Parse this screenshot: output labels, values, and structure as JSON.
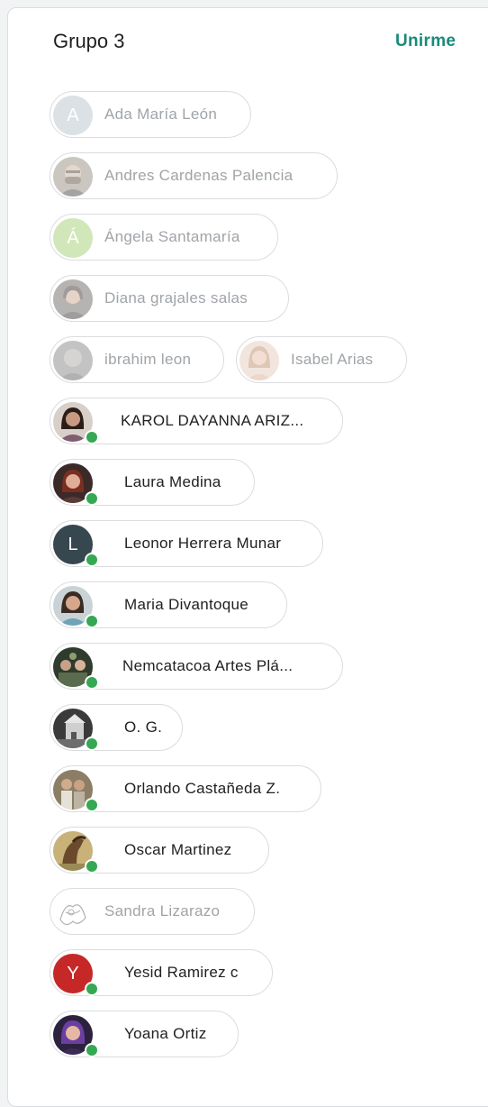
{
  "header": {
    "title": "Grupo 3",
    "join_label": "Unirme"
  },
  "colors": {
    "accent": "#1a8a7a",
    "online": "#34a853",
    "away_text": "#a0a4a8"
  },
  "participants": [
    {
      "name": "Ada María León",
      "initial": "A",
      "status": "away",
      "avatar": "letter",
      "color": "#b0bec5"
    },
    {
      "name": "Andres Cardenas Palencia",
      "status": "away",
      "avatar": "photo-man-beard-icon"
    },
    {
      "name": "Ángela Santamaría",
      "initial": "Á",
      "status": "away",
      "avatar": "letter",
      "color": "#9ccc65"
    },
    {
      "name": "Diana grajales salas",
      "status": "away",
      "avatar": "photo-woman-icon"
    },
    {
      "name": "ibrahim leon",
      "status": "away",
      "avatar": "photo-grey-icon"
    },
    {
      "name": "Isabel Arias",
      "status": "away",
      "avatar": "photo-woman-blonde-icon"
    },
    {
      "name": "KAROL DAYANNA ARIZ...",
      "status": "online",
      "avatar": "photo-woman-icon"
    },
    {
      "name": "Laura Medina",
      "status": "online",
      "avatar": "photo-woman-red-icon"
    },
    {
      "name": "Leonor Herrera Munar",
      "initial": "L",
      "status": "online",
      "avatar": "letter",
      "color": "#37474f"
    },
    {
      "name": "Maria Divantoque",
      "status": "online",
      "avatar": "photo-woman-icon"
    },
    {
      "name": "Nemcatacoa Artes Plá...",
      "status": "online",
      "avatar": "photo-group-icon"
    },
    {
      "name": "O. G.",
      "status": "online",
      "avatar": "photo-building-icon"
    },
    {
      "name": "Orlando Castañeda Z.",
      "status": "online",
      "avatar": "photo-couple-icon"
    },
    {
      "name": "Oscar Martinez",
      "status": "online",
      "avatar": "photo-horse-icon"
    },
    {
      "name": "Sandra Lizarazo",
      "status": "away",
      "avatar": "drawing-icon"
    },
    {
      "name": "Yesid Ramirez c",
      "initial": "Y",
      "status": "online",
      "avatar": "letter",
      "color": "#c62828"
    },
    {
      "name": "Yoana Ortiz",
      "status": "online",
      "avatar": "photo-woman-purple-icon"
    }
  ]
}
